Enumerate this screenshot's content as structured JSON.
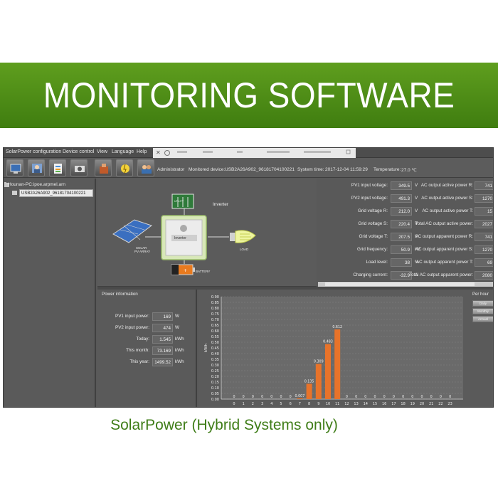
{
  "banner": {
    "title": "MONITORING SOFTWARE"
  },
  "caption": "SolarPower (Hybrid Systems only)",
  "menubar": {
    "items": [
      "SolarPower configuration",
      "Device control",
      "View",
      "Language",
      "Help"
    ]
  },
  "toolbar": {
    "buttons": [
      "config-icon",
      "user-icon",
      "data-icon",
      "camera-icon",
      "device-icon",
      "energy-icon",
      "users-icon"
    ],
    "status": {
      "user": "Administrator",
      "device_label": "Monitored device:",
      "device": "USB2A26A902_96181704100221",
      "time_label": "System time:",
      "time": "2017-12-04 11:59:29",
      "temp_label": "Temperature:",
      "temp": "27.0 ℃"
    }
  },
  "tree": {
    "root": "Hounan-PC:ipoe.arpmel.arn",
    "child": "USB2A26A902_96181704100221"
  },
  "diagram": {
    "inverter_title": "Inverter",
    "inverter_box": "Inverter",
    "utility": "UTILITY",
    "solar": "SOLAR\nPV ARRAY",
    "solar_1": "SOLAR",
    "solar_2": "PV ARRAY",
    "load": "LOAD",
    "battery": "BATTERY"
  },
  "values": {
    "left": [
      {
        "label": "PV1 input voltage:",
        "value": "349.5",
        "unit": "V"
      },
      {
        "label": "PV2 input voltage:",
        "value": "491.3",
        "unit": "V"
      },
      {
        "label": "Grid voltage R:",
        "value": "212.0",
        "unit": "V"
      },
      {
        "label": "Grid voltage S:",
        "value": "220.4",
        "unit": "V"
      },
      {
        "label": "Grid voltage T:",
        "value": "207.5",
        "unit": "V"
      },
      {
        "label": "Grid frequency:",
        "value": "50.9",
        "unit": "Hz"
      },
      {
        "label": "Load level:",
        "value": "38",
        "unit": "%"
      },
      {
        "label": "Charging current:",
        "value": "-32.9",
        "unit": "A"
      }
    ],
    "right": [
      {
        "label": "AC output active power R:",
        "value": "741"
      },
      {
        "label": "AC output active power S:",
        "value": "1270"
      },
      {
        "label": "AC output active power T:",
        "value": "15"
      },
      {
        "label": "Total AC output active power:",
        "value": "2027"
      },
      {
        "label": "AC output apparent power R:",
        "value": "741"
      },
      {
        "label": "AC output apparent power S:",
        "value": "1270"
      },
      {
        "label": "AC output apparent power T:",
        "value": "69"
      },
      {
        "label": "Total AC output apparent power:",
        "value": "2080"
      }
    ]
  },
  "power_info": {
    "title": "Power information",
    "rows": [
      {
        "label": "PV1 input power:",
        "value": "169",
        "unit": "W"
      },
      {
        "label": "PV2 input power:",
        "value": "474",
        "unit": "W"
      },
      {
        "label": "Today:",
        "value": "1.545",
        "unit": "kWh"
      },
      {
        "label": "This month:",
        "value": "73.169",
        "unit": "kWh"
      },
      {
        "label": "This year:",
        "value": "1499.52",
        "unit": "kWh"
      }
    ]
  },
  "right_panel": {
    "title": "Per hour",
    "buttons": [
      "Daily",
      "Monthly",
      "Annual"
    ]
  },
  "chart_data": {
    "type": "bar",
    "ylabel": "kWh",
    "ylim": [
      0,
      0.9
    ],
    "yticks": [
      "0.00",
      "0.05",
      "0.10",
      "0.15",
      "0.20",
      "0.25",
      "0.30",
      "0.35",
      "0.40",
      "0.45",
      "0.50",
      "0.55",
      "0.60",
      "0.65",
      "0.70",
      "0.75",
      "0.80",
      "0.85",
      "0.90"
    ],
    "categories": [
      "0",
      "1",
      "2",
      "3",
      "4",
      "5",
      "6",
      "7",
      "8",
      "9",
      "10",
      "11",
      "12",
      "13",
      "14",
      "15",
      "16",
      "17",
      "18",
      "19",
      "20",
      "21",
      "22",
      "23"
    ],
    "values": [
      0,
      0,
      0,
      0,
      0,
      0,
      0,
      0.007,
      0.135,
      0.309,
      0.483,
      0.612,
      0,
      0,
      0,
      0,
      0,
      0,
      0,
      0,
      0,
      0,
      0,
      0
    ],
    "data_labels": [
      "0",
      "0",
      "0",
      "0",
      "0",
      "0",
      "0",
      "0.007",
      "0.135",
      "0.309",
      "0.483",
      "0.612",
      "0",
      "0",
      "0",
      "0",
      "0",
      "0",
      "0",
      "0",
      "0",
      "0",
      "0",
      "0"
    ],
    "bar_color": "#e8732a",
    "grid": true
  }
}
